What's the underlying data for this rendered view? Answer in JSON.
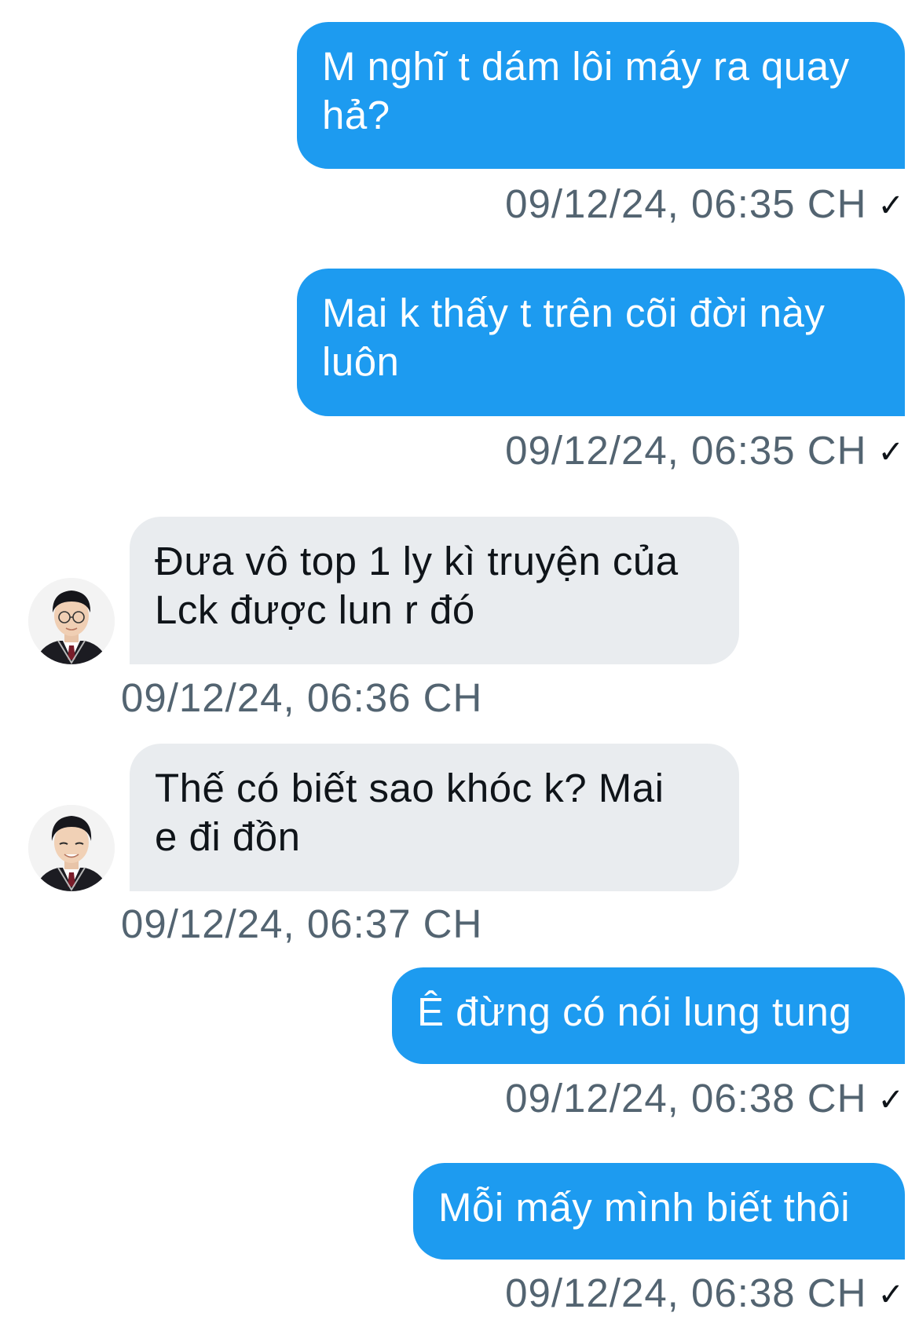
{
  "messages": [
    {
      "direction": "out",
      "text": "M nghĩ t dám lôi máy ra quay hả?",
      "lines": [
        "M nghĩ t dám lôi máy ra quay",
        "hả?"
      ],
      "timestamp": "09/12/24, 06:35 CH",
      "status_icon": "checkmark-icon"
    },
    {
      "direction": "out",
      "text": "Mai k thấy t trên cõi đời này luôn",
      "lines": [
        "Mai k thấy t trên cõi đời này",
        "luôn"
      ],
      "timestamp": "09/12/24, 06:35 CH",
      "status_icon": "checkmark-icon"
    },
    {
      "direction": "in",
      "text": "Đưa vô top 1 ly kì truyện của Lck được lun r đó",
      "lines": [
        "Đưa vô top 1 ly kì truyện của",
        "Lck được lun r đó"
      ],
      "timestamp": "09/12/24, 06:36 CH"
    },
    {
      "direction": "in",
      "text": "Thế có biết sao khóc k? Mai e đi đồn",
      "lines": [
        "Thế có biết sao khóc k? Mai",
        "e đi đồn"
      ],
      "timestamp": "09/12/24, 06:37 CH"
    },
    {
      "direction": "out",
      "text": "Ê đừng có nói lung tung",
      "lines": [
        "Ê đừng có nói lung tung"
      ],
      "timestamp": "09/12/24, 06:38 CH",
      "status_icon": "checkmark-icon"
    },
    {
      "direction": "out",
      "text": "Mỗi mấy mình biết thôi",
      "lines": [
        "Mỗi mấy mình biết thôi"
      ],
      "timestamp": "09/12/24, 06:38 CH",
      "status_icon": "checkmark-icon"
    }
  ],
  "colors": {
    "outgoing_bubble": "#1d9bf0",
    "incoming_bubble": "#e9ecef",
    "timestamp_text": "#536471",
    "background": "#ffffff"
  },
  "check_glyph": "✓"
}
